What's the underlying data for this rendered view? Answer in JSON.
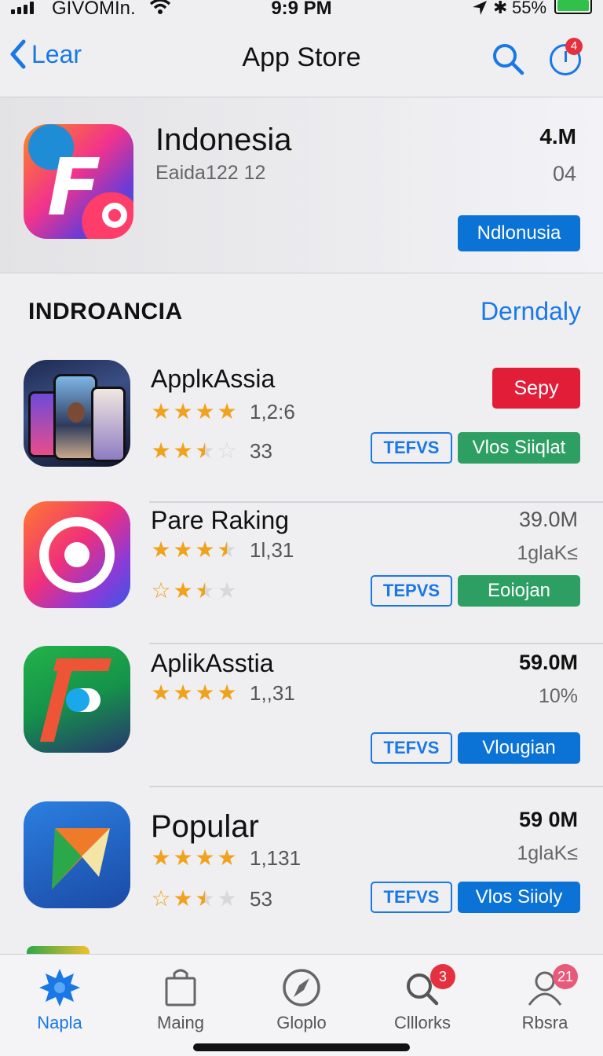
{
  "status_bar": {
    "carrier": "GIVOMIn.",
    "time": "9:9 PM",
    "battery": "55%"
  },
  "nav": {
    "back_label": "Lear",
    "title": "App Store",
    "update_badge": "4"
  },
  "featured": {
    "name": "Indonesia",
    "subtitle": "Eaida122 12",
    "size": "4.M",
    "number": "04",
    "button": "Ndlonusia"
  },
  "section": {
    "title": "INDROANCIA",
    "link": "Derndaly"
  },
  "apps": [
    {
      "name": "ApplκAssia",
      "rating_1": 4,
      "rating_1_count": "1,2:6",
      "rating_2": 2.5,
      "rating_2_count": "33",
      "top_button": "Sepy",
      "outline_button": "TEFVS",
      "fill_button": "Vlos Siiqlat",
      "fill_color": "#2e9f63"
    },
    {
      "name": "Pare Raking",
      "size": "39.0M",
      "meta": "1glaK≤",
      "rating_1": 3.5,
      "rating_1_count": "1l,31",
      "rating_2": 2.5,
      "rating_2_count": "",
      "outline_button": "TEPVS",
      "fill_button": "Eoiojan",
      "fill_color": "#2e9f63"
    },
    {
      "name": "AplikAsstia",
      "size": "59.0M",
      "meta": "10%",
      "rating_1": 4,
      "rating_1_count": "1,,31",
      "outline_button": "TEFVS",
      "fill_button": "Vlougian",
      "fill_color": "#0b72d6"
    },
    {
      "name": "Popular",
      "size": "59 0M",
      "meta": "1glaK≤",
      "rating_1": 4,
      "rating_1_count": "1,131",
      "rating_2": 2.5,
      "rating_2_count": "53",
      "outline_button": "TEFVS",
      "fill_button": "Vlos Siioly",
      "fill_color": "#0b72d6"
    }
  ],
  "tabs": [
    {
      "label": "Napla",
      "icon": "star-burst-icon",
      "active": true
    },
    {
      "label": "Maing",
      "icon": "bag-icon",
      "active": false
    },
    {
      "label": "Gloplo",
      "icon": "compass-icon",
      "active": false
    },
    {
      "label": "Clllorks",
      "icon": "search-icon",
      "badge": "3",
      "active": false
    },
    {
      "label": "Rbsra",
      "icon": "person-icon",
      "badge": "21",
      "active": false
    }
  ],
  "colors": {
    "accent": "#1a78e6",
    "star": "#f0a21c",
    "red": "#e21d37",
    "green": "#2e9f63"
  }
}
